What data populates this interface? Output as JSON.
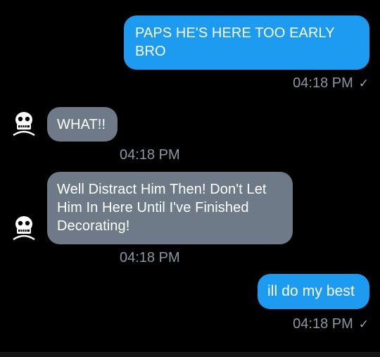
{
  "messages": [
    {
      "direction": "outgoing",
      "text": "PAPS HE'S HERE TOO EARLY BRO",
      "time": "04:18 PM",
      "status_icon": "check-icon"
    },
    {
      "direction": "incoming",
      "text": "WHAT!!",
      "time": "04:18 PM",
      "avatar_icon": "skull-avatar-icon"
    },
    {
      "direction": "incoming",
      "text": "Well Distract Him Then! Don't Let Him In Here Until I've Finished Decorating!",
      "time": "04:18 PM",
      "avatar_icon": "skull-avatar-icon"
    },
    {
      "direction": "outgoing",
      "text": "ill do my best",
      "time": "04:18 PM",
      "status_icon": "check-icon"
    }
  ],
  "check_glyph": "✓",
  "colors": {
    "background": "#000000",
    "outgoing_bubble": "#1d9bf0",
    "incoming_bubble": "#6e7a87",
    "timestamp": "#8a96a3"
  }
}
